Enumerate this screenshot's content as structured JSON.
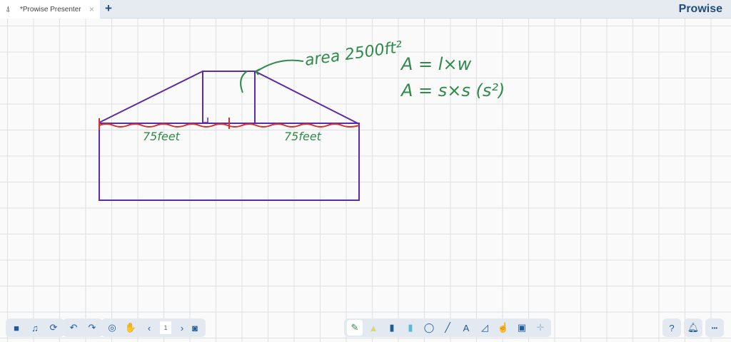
{
  "tab": {
    "title": "*Prowise Presenter",
    "icon": "presenter-icon",
    "close": "×"
  },
  "new_tab": "+",
  "logo": "Prowise",
  "whiteboard": {
    "annotations": {
      "area": "area 2500ft²",
      "formula1": "A = l×w",
      "formula2": "A = s×s (s²)",
      "left_length": "75feet",
      "right_length": "75feet"
    },
    "colors": {
      "shape": "#5b2ca6",
      "measure": "#d8302c",
      "notes": "#2e8b4a"
    }
  },
  "toolbar": {
    "page_number": "1",
    "prev": "‹",
    "next": "›",
    "help": "?",
    "more": "•••"
  }
}
